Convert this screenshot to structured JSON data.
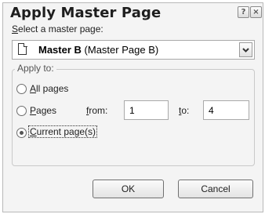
{
  "dialog": {
    "title": "Apply Master Page",
    "help_glyph": "?",
    "close_glyph": "×"
  },
  "select_label": {
    "accel": "S",
    "rest": "elect a master page:"
  },
  "master_dropdown": {
    "icon": "document-icon",
    "name": "Master B",
    "description": "(Master Page B)"
  },
  "apply_group": {
    "label": "Apply to:",
    "all_pages": {
      "accel": "A",
      "rest": "ll pages",
      "selected": false
    },
    "pages": {
      "accel": "P",
      "rest": "ages",
      "selected": false,
      "from_accel": "f",
      "from_rest": "rom:",
      "from_value": "1",
      "to_accel": "t",
      "to_rest": "o:",
      "to_value": "4"
    },
    "current": {
      "accel": "C",
      "rest": "urrent page(s)",
      "selected": true
    }
  },
  "buttons": {
    "ok": "OK",
    "cancel": "Cancel"
  }
}
